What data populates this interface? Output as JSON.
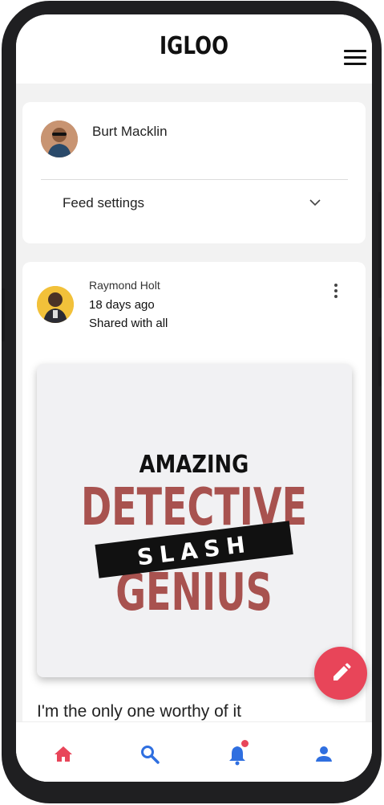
{
  "app": {
    "title": "IGLOO"
  },
  "colors": {
    "accent": "#e84559",
    "nav_blue": "#2f6fe0",
    "detective_red": "#a8524f",
    "frame": "#1f1f21"
  },
  "header": {
    "menu_icon": "hamburger-menu-icon"
  },
  "profile": {
    "name": "Burt Macklin",
    "feed_settings_label": "Feed settings",
    "feed_settings_icon": "chevron-down-icon"
  },
  "post": {
    "author": "Raymond Holt",
    "time": "18 days ago",
    "visibility": "Shared with all",
    "menu_icon": "more-vert-icon",
    "image_text": {
      "line1": "AMAZING",
      "line2": "DETECTIVE",
      "line3": "SLASH",
      "line4": "GENIUS"
    },
    "caption": "I'm the only one worthy of it"
  },
  "fab": {
    "icon": "pencil-icon"
  },
  "bottom_nav": {
    "items": [
      {
        "icon": "home-icon",
        "active": true
      },
      {
        "icon": "search-icon",
        "active": false
      },
      {
        "icon": "bell-icon",
        "active": false,
        "has_notification": true
      },
      {
        "icon": "user-icon",
        "active": false
      }
    ]
  }
}
